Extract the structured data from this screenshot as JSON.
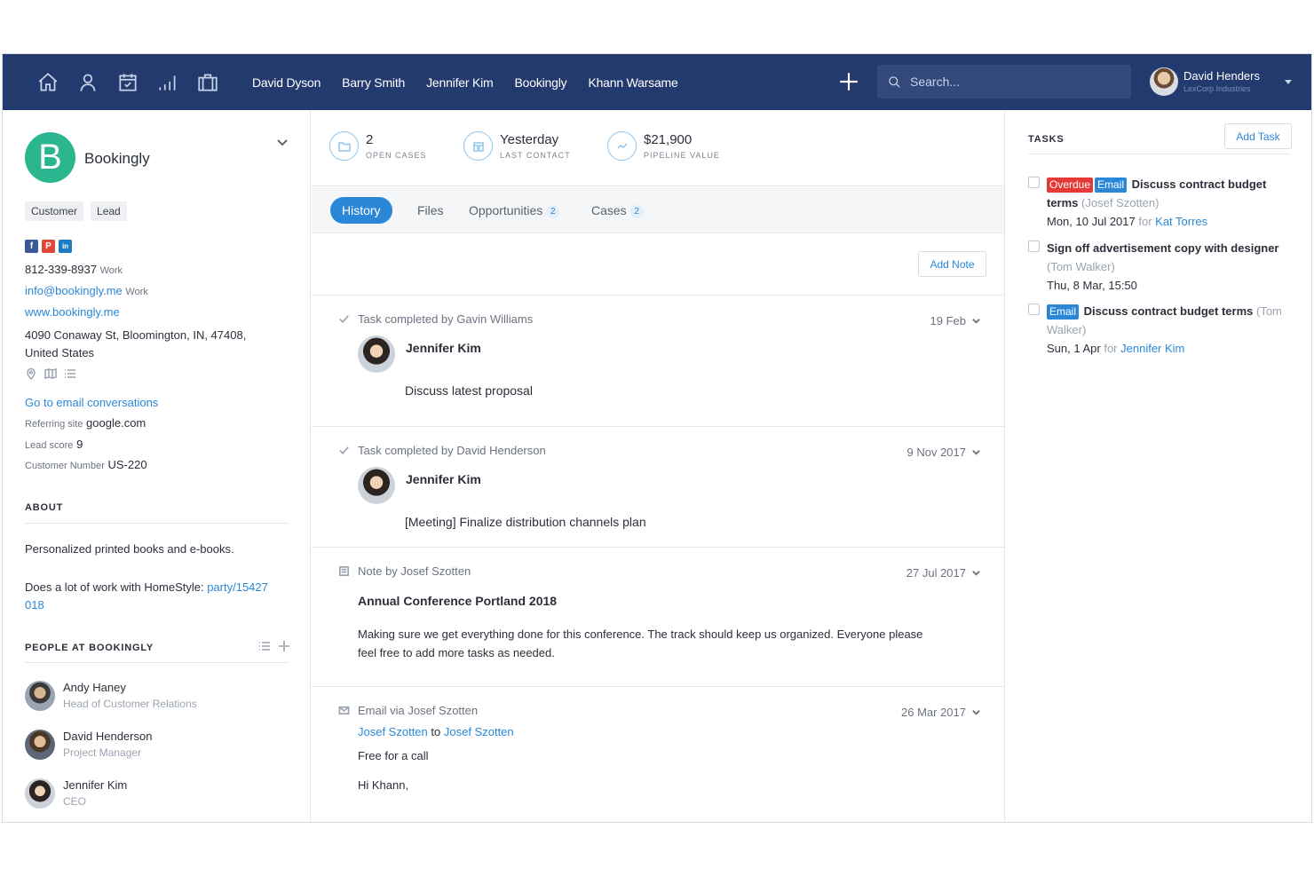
{
  "nav": {
    "icons": [
      "home-icon",
      "person-icon",
      "calendar-icon",
      "chart-icon",
      "briefcase-icon"
    ],
    "links": [
      "David Dyson",
      "Barry Smith",
      "Jennifer Kim",
      "Bookingly",
      "Khann Warsame"
    ],
    "search_placeholder": "Search...",
    "user_name": "David Henders",
    "user_company": "LexCorp Industries"
  },
  "org": {
    "initial": "B",
    "name": "Bookingly",
    "tags": [
      "Customer",
      "Lead"
    ],
    "social": [
      "f",
      "P",
      "in"
    ],
    "phone": "812-339-8937",
    "phone_type": "Work",
    "email": "info@bookingly.me",
    "email_type": "Work",
    "website": "www.bookingly.me",
    "address_line1": "4090 Conaway St, Bloomington, IN, 47408,",
    "address_line2": "United States",
    "email_conversations": "Go to email conversations",
    "referring_label": "Referring site",
    "referring_value": "google.com",
    "lead_score_label": "Lead score",
    "lead_score_value": "9",
    "customer_number_label": "Customer Number",
    "customer_number_value": "US-220"
  },
  "about": {
    "heading": "ABOUT",
    "line1": "Personalized printed books and e-books.",
    "line2_prefix": "Does a lot of work with HomeStyle:",
    "line2_link_a": "party/15427",
    "line2_link_b": "018"
  },
  "people": {
    "heading": "PEOPLE AT BOOKINGLY",
    "items": [
      {
        "name": "Andy Haney",
        "title": "Head of Customer Relations"
      },
      {
        "name": "David Henderson",
        "title": "Project Manager"
      },
      {
        "name": "Jennifer Kim",
        "title": "CEO"
      }
    ]
  },
  "stats": [
    {
      "value": "2",
      "label": "OPEN CASES",
      "icon": "folder-icon"
    },
    {
      "value": "Yesterday",
      "label": "LAST CONTACT",
      "icon": "calendar-icon"
    },
    {
      "value": "$21,900",
      "label": "PIPELINE VALUE",
      "icon": "trend-icon"
    }
  ],
  "tabs": [
    {
      "label": "History",
      "count": ""
    },
    {
      "label": "Files",
      "count": ""
    },
    {
      "label": "Opportunities",
      "count": "2"
    },
    {
      "label": "Cases",
      "count": "2"
    }
  ],
  "add_note": "Add Note",
  "entries": [
    {
      "kind": "Task completed by Gavin Williams",
      "date": "19 Feb",
      "person": "Jennifer Kim",
      "text": "Discuss latest proposal"
    },
    {
      "kind": "Task completed by David Henderson",
      "date": "9 Nov 2017",
      "person": "Jennifer Kim",
      "text": "[Meeting] Finalize distribution channels plan"
    },
    {
      "kind": "Note by Josef Szotten",
      "date": "27 Jul 2017",
      "title": "Annual Conference Portland 2018",
      "body": "Making sure we get everything done for this conference. The track should keep us organized. Everyone please feel free to add more tasks as needed."
    },
    {
      "kind": "Email via Josef Szotten",
      "date": "26 Mar 2017",
      "from": "Josef Szotten",
      "to_word": "to",
      "to": "Josef Szotten",
      "subject": "Free for a call",
      "greeting": "Hi Khann,"
    }
  ],
  "tasks": {
    "heading": "TASKS",
    "add_label": "Add Task",
    "items": [
      {
        "labels": [
          "Overdue",
          "Email"
        ],
        "title_a": "Discuss contract budget",
        "title_b": "terms",
        "owner": "(Josef Szotten)",
        "date": "Mon, 10 Jul 2017",
        "for_word": "for",
        "assignee": "Kat Torres"
      },
      {
        "labels": [],
        "title_a": "Sign off advertisement copy with designer",
        "owner": "(Tom Walker)",
        "date": "Thu, 8 Mar, 15:50"
      },
      {
        "labels": [
          "Email"
        ],
        "title_a": "Discuss contract budget terms",
        "owner_a": "(Tom",
        "owner_b": "Walker)",
        "date": "Sun, 1 Apr",
        "for_word": "for",
        "assignee": "Jennifer Kim"
      }
    ]
  },
  "colors": {
    "nav_bg": "#233a6e",
    "accent": "#2a87d8",
    "logo": "#2bb690",
    "overdue": "#e53935"
  }
}
